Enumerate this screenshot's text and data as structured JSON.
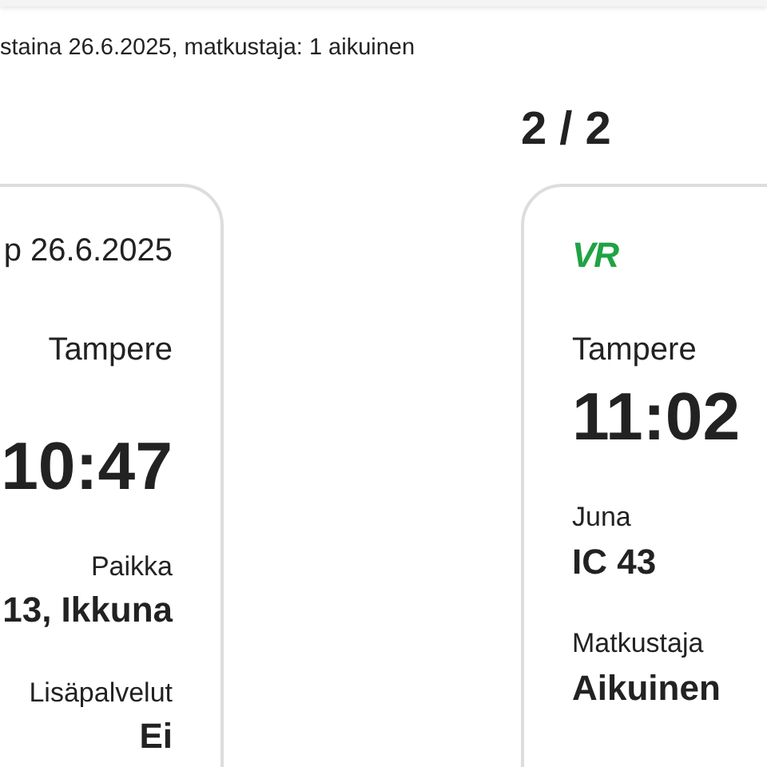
{
  "summary": "staina 26.6.2025, matkustaja: 1 aikuinen",
  "cards": [
    {
      "kind": "end",
      "items": [
        {
          "kind": "date",
          "text": "p 26.6.2025"
        },
        {
          "kind": "station",
          "text": "Tampere"
        },
        {
          "kind": "time",
          "text": "10:47"
        },
        {
          "kind": "label",
          "text": "Paikka"
        },
        {
          "kind": "value",
          "text": "13, Ikkuna"
        },
        {
          "kind": "label",
          "text": "Lisäpalvelut"
        },
        {
          "kind": "value",
          "text": "Ei"
        }
      ]
    },
    {
      "heading": "2 / 2",
      "kind": "start",
      "items": [
        {
          "kind": "logo",
          "text": "VR"
        },
        {
          "kind": "station",
          "text": "Tampere"
        },
        {
          "kind": "time",
          "text": "11:02"
        },
        {
          "kind": "label",
          "text": "Juna"
        },
        {
          "kind": "value",
          "text": "IC 43"
        },
        {
          "kind": "label",
          "text": "Matkustaja"
        },
        {
          "kind": "value",
          "text": "Aikuinen"
        }
      ]
    }
  ]
}
